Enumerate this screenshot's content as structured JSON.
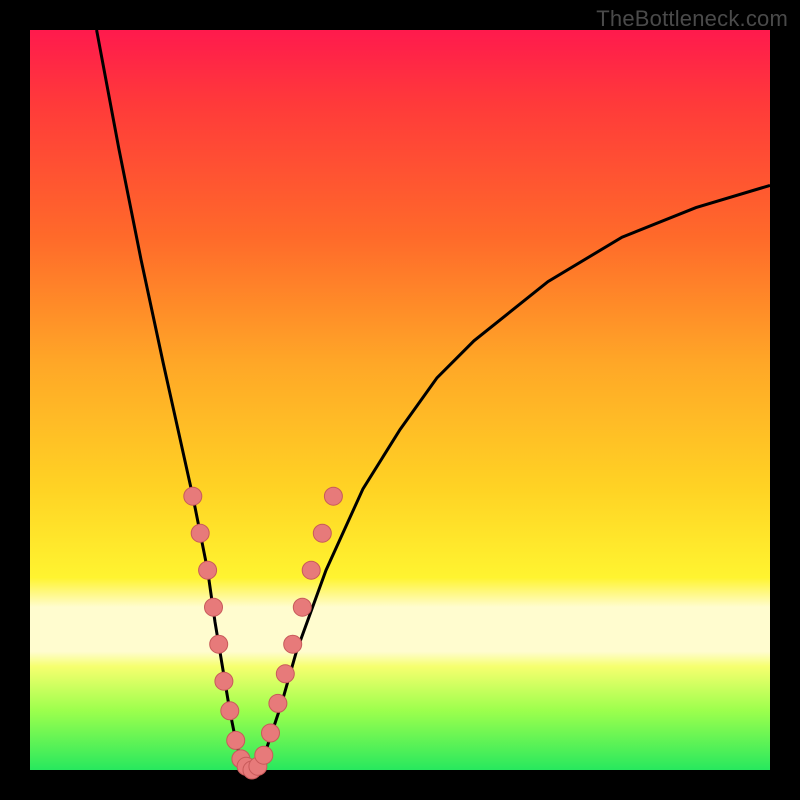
{
  "watermark": "TheBottleneck.com",
  "colors": {
    "frame": "#000000",
    "curve": "#000000",
    "marker_fill": "#e77a7a",
    "marker_stroke": "#c85a5a"
  },
  "chart_data": {
    "type": "line",
    "title": "",
    "xlabel": "",
    "ylabel": "",
    "xlim": [
      0,
      100
    ],
    "ylim": [
      0,
      100
    ],
    "series": [
      {
        "name": "bottleneck-curve",
        "x": [
          9,
          12,
          15,
          18,
          20,
          22,
          24,
          25,
          26,
          27,
          28,
          29,
          30,
          32,
          34,
          36,
          40,
          45,
          50,
          55,
          60,
          70,
          80,
          90,
          100
        ],
        "y": [
          100,
          84,
          69,
          55,
          46,
          37,
          27,
          20,
          14,
          8,
          3,
          1,
          0,
          3,
          9,
          16,
          27,
          38,
          46,
          53,
          58,
          66,
          72,
          76,
          79
        ]
      }
    ],
    "markers": {
      "name": "highlight-points",
      "points": [
        {
          "x": 22.0,
          "y": 37
        },
        {
          "x": 23.0,
          "y": 32
        },
        {
          "x": 24.0,
          "y": 27
        },
        {
          "x": 24.8,
          "y": 22
        },
        {
          "x": 25.5,
          "y": 17
        },
        {
          "x": 26.2,
          "y": 12
        },
        {
          "x": 27.0,
          "y": 8
        },
        {
          "x": 27.8,
          "y": 4
        },
        {
          "x": 28.5,
          "y": 1.5
        },
        {
          "x": 29.2,
          "y": 0.5
        },
        {
          "x": 30.0,
          "y": 0
        },
        {
          "x": 30.8,
          "y": 0.5
        },
        {
          "x": 31.6,
          "y": 2
        },
        {
          "x": 32.5,
          "y": 5
        },
        {
          "x": 33.5,
          "y": 9
        },
        {
          "x": 34.5,
          "y": 13
        },
        {
          "x": 35.5,
          "y": 17
        },
        {
          "x": 36.8,
          "y": 22
        },
        {
          "x": 38.0,
          "y": 27
        },
        {
          "x": 39.5,
          "y": 32
        },
        {
          "x": 41.0,
          "y": 37
        }
      ]
    }
  }
}
